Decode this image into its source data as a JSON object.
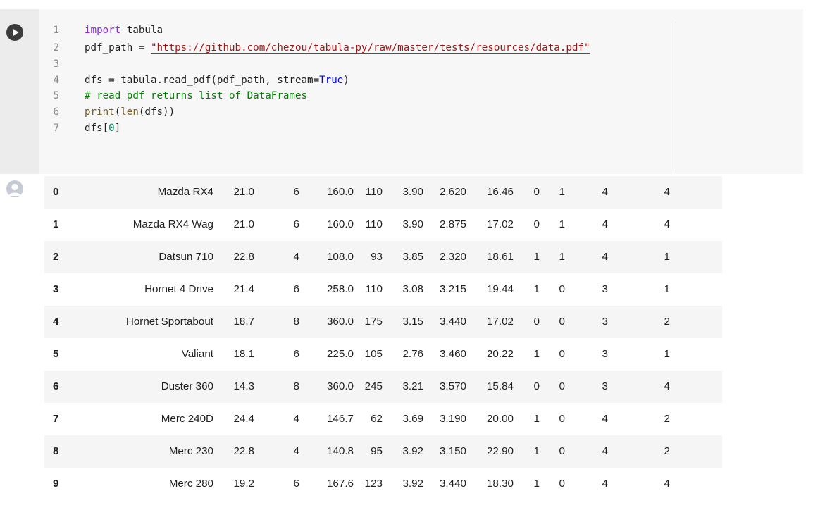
{
  "cell": {
    "code_lines": [
      {
        "n": "1",
        "tokens": [
          {
            "t": "import",
            "c": "kw"
          },
          {
            "t": " tabula",
            "c": ""
          }
        ]
      },
      {
        "n": "2",
        "tokens": [
          {
            "t": "pdf_path = ",
            "c": ""
          },
          {
            "t": "\"https://github.com/chezou/tabula-py/raw/master/tests/resources/data.pdf\"",
            "c": "str"
          }
        ]
      },
      {
        "n": "3",
        "tokens": []
      },
      {
        "n": "4",
        "tokens": [
          {
            "t": "dfs = tabula.read_pdf(pdf_path, stream=",
            "c": ""
          },
          {
            "t": "True",
            "c": "const"
          },
          {
            "t": ")",
            "c": ""
          }
        ]
      },
      {
        "n": "5",
        "tokens": [
          {
            "t": "# read_pdf returns list of DataFrames",
            "c": "cmt"
          }
        ]
      },
      {
        "n": "6",
        "tokens": [
          {
            "t": "print",
            "c": "fn"
          },
          {
            "t": "(",
            "c": ""
          },
          {
            "t": "len",
            "c": "fn"
          },
          {
            "t": "(dfs))",
            "c": ""
          }
        ]
      },
      {
        "n": "7",
        "tokens": [
          {
            "t": "dfs[",
            "c": ""
          },
          {
            "t": "0",
            "c": "num"
          },
          {
            "t": "]",
            "c": ""
          }
        ]
      }
    ]
  },
  "output": {
    "rows": [
      {
        "i": "0",
        "name": "Mazda RX4",
        "v": [
          "21.0",
          "6",
          "160.0",
          "110",
          "3.90",
          "2.620",
          "16.46",
          "0",
          "1",
          "4",
          "4"
        ]
      },
      {
        "i": "1",
        "name": "Mazda RX4 Wag",
        "v": [
          "21.0",
          "6",
          "160.0",
          "110",
          "3.90",
          "2.875",
          "17.02",
          "0",
          "1",
          "4",
          "4"
        ]
      },
      {
        "i": "2",
        "name": "Datsun 710",
        "v": [
          "22.8",
          "4",
          "108.0",
          "93",
          "3.85",
          "2.320",
          "18.61",
          "1",
          "1",
          "4",
          "1"
        ]
      },
      {
        "i": "3",
        "name": "Hornet 4 Drive",
        "v": [
          "21.4",
          "6",
          "258.0",
          "110",
          "3.08",
          "3.215",
          "19.44",
          "1",
          "0",
          "3",
          "1"
        ]
      },
      {
        "i": "4",
        "name": "Hornet Sportabout",
        "v": [
          "18.7",
          "8",
          "360.0",
          "175",
          "3.15",
          "3.440",
          "17.02",
          "0",
          "0",
          "3",
          "2"
        ]
      },
      {
        "i": "5",
        "name": "Valiant",
        "v": [
          "18.1",
          "6",
          "225.0",
          "105",
          "2.76",
          "3.460",
          "20.22",
          "1",
          "0",
          "3",
          "1"
        ]
      },
      {
        "i": "6",
        "name": "Duster 360",
        "v": [
          "14.3",
          "8",
          "360.0",
          "245",
          "3.21",
          "3.570",
          "15.84",
          "0",
          "0",
          "3",
          "4"
        ]
      },
      {
        "i": "7",
        "name": "Merc 240D",
        "v": [
          "24.4",
          "4",
          "146.7",
          "62",
          "3.69",
          "3.190",
          "20.00",
          "1",
          "0",
          "4",
          "2"
        ]
      },
      {
        "i": "8",
        "name": "Merc 230",
        "v": [
          "22.8",
          "4",
          "140.8",
          "95",
          "3.92",
          "3.150",
          "22.90",
          "1",
          "0",
          "4",
          "2"
        ]
      },
      {
        "i": "9",
        "name": "Merc 280",
        "v": [
          "19.2",
          "6",
          "167.6",
          "123",
          "3.92",
          "3.440",
          "18.30",
          "1",
          "0",
          "4",
          "4"
        ]
      }
    ]
  }
}
